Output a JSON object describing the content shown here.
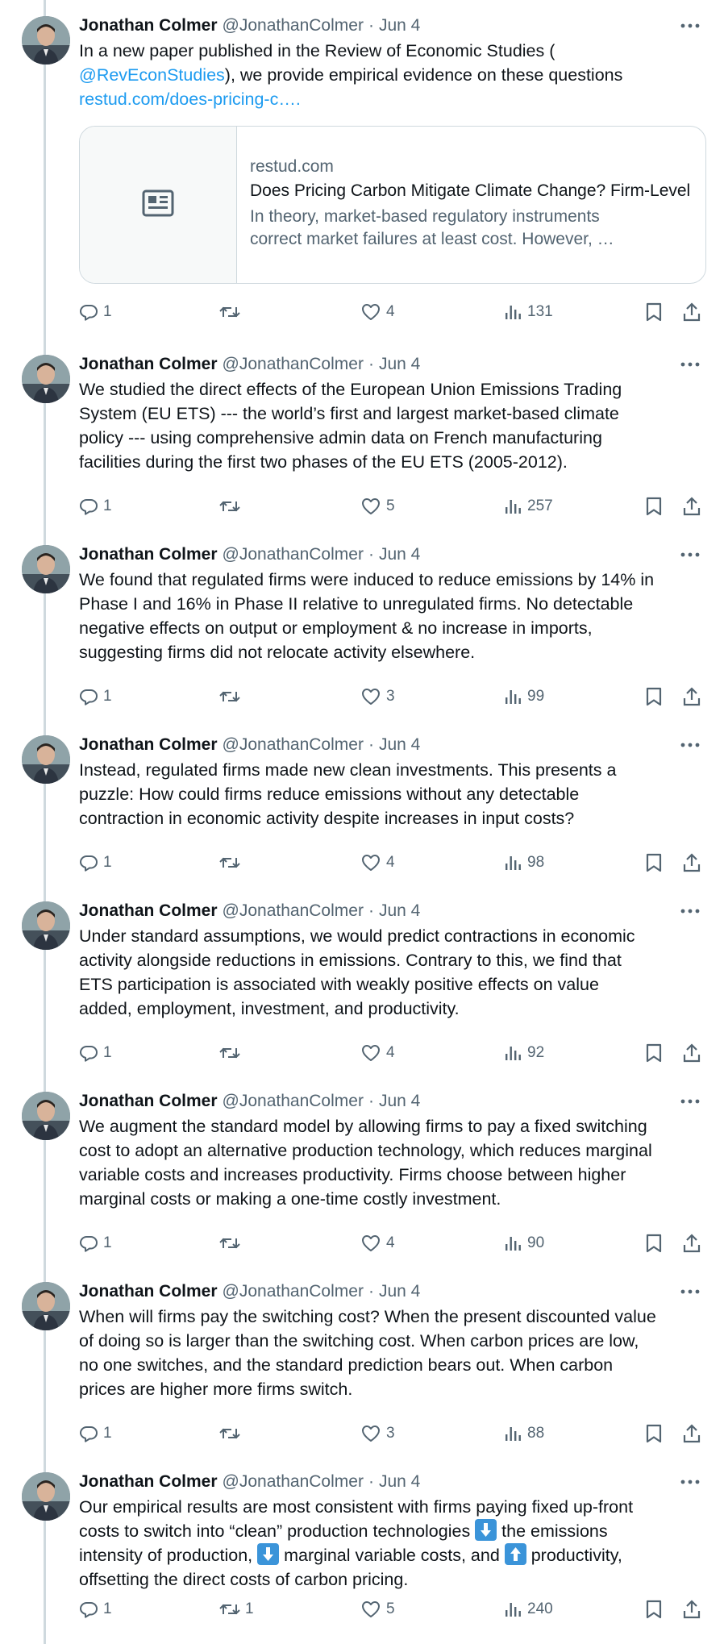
{
  "tweets": [
    {
      "name": "Jonathan Colmer",
      "handle": "@JonathanColmer",
      "separator": "·",
      "date": "Jun 4",
      "text_before": "In a new paper published in the Review of Economic Studies (",
      "mention": "@RevEconStudies",
      "text_after": "), we provide empirical evidence on these questions",
      "url": "restud.com/does-pricing-c….",
      "card": {
        "domain": "restud.com",
        "title": "Does Pricing Carbon Mitigate Climate Change? Firm-Level Evidence from the European Union Emissions Trading System",
        "desc_line1": "In theory, market-based regulatory instruments",
        "desc_line2": "correct market failures at least cost. However, …"
      },
      "replies": "1",
      "retweets": "",
      "likes": "4",
      "views": "131"
    },
    {
      "name": "Jonathan Colmer",
      "handle": "@JonathanColmer",
      "separator": "·",
      "date": "Jun 4",
      "lines": [
        "We studied the direct effects of the European Union Emissions Trading",
        "System (EU ETS) --- the world’s first and largest market-based climate",
        "policy --- using comprehensive admin data on French manufacturing",
        "facilities during the first two phases of the EU ETS (2005-2012)."
      ],
      "replies": "1",
      "retweets": "",
      "likes": "5",
      "views": "257"
    },
    {
      "name": "Jonathan Colmer",
      "handle": "@JonathanColmer",
      "separator": "·",
      "date": "Jun 4",
      "lines": [
        "We found that regulated firms were induced to reduce emissions by 14% in",
        "Phase I and 16% in Phase II relative to unregulated firms. No detectable",
        "negative effects on output or employment & no increase in imports,",
        "suggesting firms did not relocate activity elsewhere."
      ],
      "replies": "1",
      "retweets": "",
      "likes": "3",
      "views": "99"
    },
    {
      "name": "Jonathan Colmer",
      "handle": "@JonathanColmer",
      "separator": "·",
      "date": "Jun 4",
      "lines": [
        "Instead, regulated firms made new clean investments. This presents a",
        "puzzle: How could firms reduce emissions without any detectable",
        "contraction in economic activity despite increases in input costs?"
      ],
      "replies": "1",
      "retweets": "",
      "likes": "4",
      "views": "98"
    },
    {
      "name": "Jonathan Colmer",
      "handle": "@JonathanColmer",
      "separator": "·",
      "date": "Jun 4",
      "lines": [
        "Under standard assumptions, we would predict contractions in economic",
        "activity alongside reductions in emissions. Contrary to this, we find that",
        "ETS participation is associated with weakly positive effects on value",
        "added, employment, investment, and productivity."
      ],
      "replies": "1",
      "retweets": "",
      "likes": "4",
      "views": "92"
    },
    {
      "name": "Jonathan Colmer",
      "handle": "@JonathanColmer",
      "separator": "·",
      "date": "Jun 4",
      "lines": [
        "We augment the standard model by allowing firms to pay a fixed switching",
        "cost to adopt an alternative production technology, which reduces marginal",
        "variable costs and increases productivity. Firms choose between higher",
        "marginal costs or making a one-time costly investment."
      ],
      "replies": "1",
      "retweets": "",
      "likes": "4",
      "views": "90"
    },
    {
      "name": "Jonathan Colmer",
      "handle": "@JonathanColmer",
      "separator": "·",
      "date": "Jun 4",
      "lines": [
        "When will firms pay the switching cost? When the present discounted value",
        "of doing so is larger than the switching cost. When carbon prices are low,",
        "no one switches, and the standard prediction bears out. When carbon",
        "prices are higher more firms switch."
      ],
      "replies": "1",
      "retweets": "",
      "likes": "3",
      "views": "88"
    },
    {
      "name": "Jonathan Colmer",
      "handle": "@JonathanColmer",
      "separator": "·",
      "date": "Jun 4",
      "line1": "Our empirical results are most consistent with firms paying fixed up-front",
      "line2_a": "costs to switch into “clean” production technologies ",
      "line2_b": " the emissions",
      "line3_a": "intensity of production, ",
      "line3_b": " marginal variable costs, and ",
      "line3_c": " productivity,",
      "line4": "offsetting the direct costs of carbon pricing.",
      "replies": "1",
      "retweets": "1",
      "likes": "5",
      "views": "240"
    }
  ],
  "icons": {
    "reply": "reply-icon",
    "retweet": "retweet-icon",
    "like": "like-icon",
    "views": "views-icon",
    "bookmark": "bookmark-icon",
    "share": "share-icon",
    "more": "more-icon",
    "down_arrow_emoji": "down-arrow-emoji",
    "up_arrow_emoji": "up-arrow-emoji"
  },
  "colors": {
    "link": "#1d9bf0",
    "text": "#0f1419",
    "secondary": "#536471",
    "border": "#cfd9de",
    "emoji_box": "#3b94d9"
  }
}
